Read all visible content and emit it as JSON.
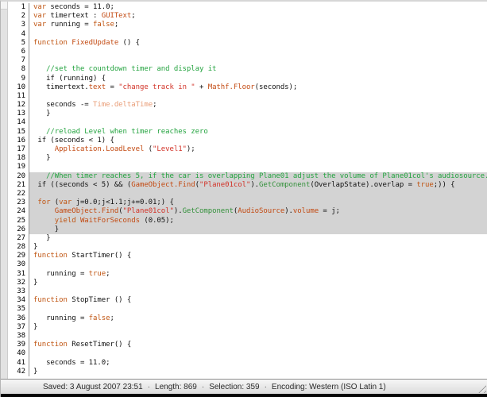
{
  "editor": {
    "lines": [
      {
        "n": 1,
        "sel": false,
        "tk": [
          {
            "t": "var",
            "c": "k"
          },
          {
            "t": " seconds = 11.0;",
            "c": "p"
          }
        ]
      },
      {
        "n": 2,
        "sel": false,
        "tk": [
          {
            "t": "var",
            "c": "k"
          },
          {
            "t": " timertext : ",
            "c": "p"
          },
          {
            "t": "GUIText",
            "c": "a"
          },
          {
            "t": ";",
            "c": "p"
          }
        ]
      },
      {
        "n": 3,
        "sel": false,
        "tk": [
          {
            "t": "var",
            "c": "k"
          },
          {
            "t": " running = ",
            "c": "p"
          },
          {
            "t": "false",
            "c": "k"
          },
          {
            "t": ";",
            "c": "p"
          }
        ]
      },
      {
        "n": 4,
        "sel": false,
        "tk": []
      },
      {
        "n": 5,
        "sel": false,
        "tk": [
          {
            "t": "function",
            "c": "k"
          },
          {
            "t": " ",
            "c": "p"
          },
          {
            "t": "FixedUpdate",
            "c": "a"
          },
          {
            "t": " () {",
            "c": "p"
          }
        ]
      },
      {
        "n": 6,
        "sel": false,
        "tk": []
      },
      {
        "n": 7,
        "sel": false,
        "tk": []
      },
      {
        "n": 8,
        "sel": false,
        "tk": [
          {
            "t": "   ",
            "c": "p"
          },
          {
            "t": "//set the countdown timer and display it",
            "c": "c"
          }
        ]
      },
      {
        "n": 9,
        "sel": false,
        "tk": [
          {
            "t": "   if (running) {",
            "c": "p"
          }
        ]
      },
      {
        "n": 10,
        "sel": false,
        "tk": [
          {
            "t": "   timertext.",
            "c": "p"
          },
          {
            "t": "text",
            "c": "a"
          },
          {
            "t": " = ",
            "c": "p"
          },
          {
            "t": "\"change track in \"",
            "c": "s"
          },
          {
            "t": " + ",
            "c": "p"
          },
          {
            "t": "Mathf.Floor",
            "c": "a"
          },
          {
            "t": "(seconds);",
            "c": "p"
          }
        ]
      },
      {
        "n": 11,
        "sel": false,
        "tk": []
      },
      {
        "n": 12,
        "sel": false,
        "tk": [
          {
            "t": "   seconds -= ",
            "c": "p"
          },
          {
            "t": "Time.deltaTime",
            "c": "u"
          },
          {
            "t": ";",
            "c": "p"
          }
        ]
      },
      {
        "n": 13,
        "sel": false,
        "tk": [
          {
            "t": "   }",
            "c": "p"
          }
        ]
      },
      {
        "n": 14,
        "sel": false,
        "tk": []
      },
      {
        "n": 15,
        "sel": false,
        "tk": [
          {
            "t": "   ",
            "c": "p"
          },
          {
            "t": "//reload Level when timer reaches zero",
            "c": "c"
          }
        ]
      },
      {
        "n": 16,
        "sel": false,
        "tk": [
          {
            "t": " if (seconds < 1) {",
            "c": "p"
          }
        ]
      },
      {
        "n": 17,
        "sel": false,
        "tk": [
          {
            "t": "     ",
            "c": "p"
          },
          {
            "t": "Application.LoadLevel",
            "c": "a"
          },
          {
            "t": " (",
            "c": "p"
          },
          {
            "t": "\"Level1\"",
            "c": "s"
          },
          {
            "t": ");",
            "c": "p"
          }
        ]
      },
      {
        "n": 18,
        "sel": false,
        "tk": [
          {
            "t": "   }",
            "c": "p"
          }
        ]
      },
      {
        "n": 19,
        "sel": false,
        "tk": []
      },
      {
        "n": 20,
        "sel": true,
        "tk": [
          {
            "t": "   ",
            "c": "p"
          },
          {
            "t": "//When timer reaches 5, if the car is overlapping Plane01 adjust the volume of Plane01col's audiosource.",
            "c": "c"
          }
        ]
      },
      {
        "n": 21,
        "sel": true,
        "tk": [
          {
            "t": " if ((seconds < 5) && (",
            "c": "p"
          },
          {
            "t": "GameObject.Find",
            "c": "a"
          },
          {
            "t": "(",
            "c": "p"
          },
          {
            "t": "\"Plane01col\"",
            "c": "s"
          },
          {
            "t": ").",
            "c": "p"
          },
          {
            "t": "GetComponent",
            "c": "g"
          },
          {
            "t": "(OverlapState).overlap = ",
            "c": "p"
          },
          {
            "t": "true",
            "c": "k"
          },
          {
            "t": ";)) {",
            "c": "p"
          }
        ]
      },
      {
        "n": 22,
        "sel": true,
        "tk": []
      },
      {
        "n": 23,
        "sel": true,
        "tk": [
          {
            "t": " ",
            "c": "p"
          },
          {
            "t": "for",
            "c": "k"
          },
          {
            "t": " (",
            "c": "p"
          },
          {
            "t": "var",
            "c": "k"
          },
          {
            "t": " j=0.0;j<1.1;j+=0.01;) {",
            "c": "p"
          }
        ]
      },
      {
        "n": 24,
        "sel": true,
        "tk": [
          {
            "t": "     ",
            "c": "p"
          },
          {
            "t": "GameObject.Find",
            "c": "a"
          },
          {
            "t": "(",
            "c": "p"
          },
          {
            "t": "\"Plane01col\"",
            "c": "s"
          },
          {
            "t": ").",
            "c": "p"
          },
          {
            "t": "GetComponent",
            "c": "g"
          },
          {
            "t": "(",
            "c": "p"
          },
          {
            "t": "AudioSource",
            "c": "a"
          },
          {
            "t": ").",
            "c": "p"
          },
          {
            "t": "volume",
            "c": "a"
          },
          {
            "t": " = j;",
            "c": "p"
          }
        ]
      },
      {
        "n": 25,
        "sel": true,
        "tk": [
          {
            "t": "     ",
            "c": "p"
          },
          {
            "t": "yield",
            "c": "k"
          },
          {
            "t": " ",
            "c": "p"
          },
          {
            "t": "WaitForSeconds",
            "c": "a"
          },
          {
            "t": " (0.05);",
            "c": "p"
          }
        ]
      },
      {
        "n": 26,
        "sel": true,
        "tk": [
          {
            "t": "     }",
            "c": "p"
          }
        ]
      },
      {
        "n": 27,
        "sel": false,
        "tk": [
          {
            "t": "   }",
            "c": "p"
          }
        ]
      },
      {
        "n": 28,
        "sel": false,
        "tk": [
          {
            "t": "}",
            "c": "p"
          }
        ]
      },
      {
        "n": 29,
        "sel": false,
        "tk": [
          {
            "t": "function",
            "c": "k"
          },
          {
            "t": " StartTimer() {",
            "c": "p"
          }
        ]
      },
      {
        "n": 30,
        "sel": false,
        "tk": []
      },
      {
        "n": 31,
        "sel": false,
        "tk": [
          {
            "t": "   running = ",
            "c": "p"
          },
          {
            "t": "true",
            "c": "k"
          },
          {
            "t": ";",
            "c": "p"
          }
        ]
      },
      {
        "n": 32,
        "sel": false,
        "tk": [
          {
            "t": "}",
            "c": "p"
          }
        ]
      },
      {
        "n": 33,
        "sel": false,
        "tk": []
      },
      {
        "n": 34,
        "sel": false,
        "tk": [
          {
            "t": "function",
            "c": "k"
          },
          {
            "t": " StopTimer () {",
            "c": "p"
          }
        ]
      },
      {
        "n": 35,
        "sel": false,
        "tk": []
      },
      {
        "n": 36,
        "sel": false,
        "tk": [
          {
            "t": "   running = ",
            "c": "p"
          },
          {
            "t": "false",
            "c": "k"
          },
          {
            "t": ";",
            "c": "p"
          }
        ]
      },
      {
        "n": 37,
        "sel": false,
        "tk": [
          {
            "t": "}",
            "c": "p"
          }
        ]
      },
      {
        "n": 38,
        "sel": false,
        "tk": []
      },
      {
        "n": 39,
        "sel": false,
        "tk": [
          {
            "t": "function",
            "c": "k"
          },
          {
            "t": " ResetTimer() {",
            "c": "p"
          }
        ]
      },
      {
        "n": 40,
        "sel": false,
        "tk": []
      },
      {
        "n": 41,
        "sel": false,
        "tk": [
          {
            "t": "   seconds = 11.0;",
            "c": "p"
          }
        ]
      },
      {
        "n": 42,
        "sel": false,
        "tk": [
          {
            "t": "}",
            "c": "p"
          }
        ]
      }
    ]
  },
  "status": {
    "parts": [
      "Saved: 3 August 2007 23:51",
      "Length: 869",
      "Selection: 359",
      "Encoding: Western (ISO Latin 1)"
    ],
    "separator": "·"
  },
  "colors": {
    "keyword": "#c05512",
    "api_class": "#c34a12",
    "string": "#d23227",
    "unity_method_green": "#35913c",
    "unity_value_salmon": "#e99d77",
    "comment": "#23a33f",
    "plain_text": "#111111",
    "selection_background": "#d3d3d3",
    "gutter_separator": "#8f8f8f"
  }
}
